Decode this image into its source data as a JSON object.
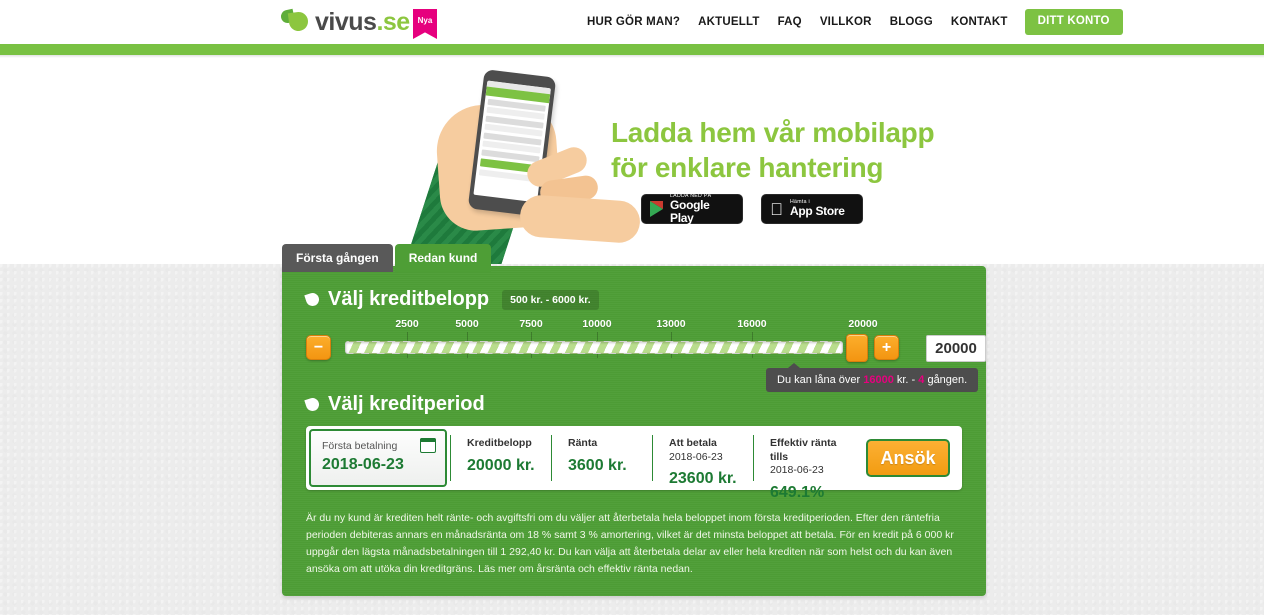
{
  "header": {
    "logo": {
      "name": "vivus",
      "domain": ".se",
      "ribbon": "Nya"
    },
    "nav": [
      {
        "label": "HUR GÖR MAN?",
        "name": "nav-hur-gor-man"
      },
      {
        "label": "AKTUELLT",
        "name": "nav-aktuellt"
      },
      {
        "label": "FAQ",
        "name": "nav-faq"
      },
      {
        "label": "VILLKOR",
        "name": "nav-villkor"
      },
      {
        "label": "BLOGG",
        "name": "nav-blogg"
      },
      {
        "label": "KONTAKT",
        "name": "nav-kontakt"
      }
    ],
    "cta": "DITT KONTO"
  },
  "hero": {
    "heading_line1": "Ladda hem vår mobilapp",
    "heading_line2": "för enklare hantering",
    "badges": [
      {
        "top": "LADDA NED PÅ",
        "bottom": "Google Play",
        "icon": "google-play-icon"
      },
      {
        "top": "Hämta i",
        "bottom": "App Store",
        "icon": "apple-icon"
      }
    ]
  },
  "tabs": [
    {
      "label": "Första gången",
      "active": false
    },
    {
      "label": "Redan kund",
      "active": true
    }
  ],
  "calculator": {
    "amount_section": {
      "title": "Välj kreditbelopp",
      "range_pill": "500 kr. - 6000 kr.",
      "ticks": [
        "2500",
        "5000",
        "7500",
        "10000",
        "13000",
        "16000",
        "20000"
      ],
      "minus_label": "−",
      "plus_label": "+",
      "value": "20000",
      "tooltip_prefix": "Du kan låna över ",
      "tooltip_amount": "16000",
      "tooltip_middle": " kr. - ",
      "tooltip_count": "4",
      "tooltip_suffix": " gången."
    },
    "period_section": {
      "title": "Välj kreditperiod"
    },
    "summary": {
      "date_card": {
        "label": "Första betalning",
        "value": "2018-06-23"
      },
      "cells": [
        {
          "label": "Kreditbelopp",
          "sub": "",
          "value": "20000 kr."
        },
        {
          "label": "Ränta",
          "sub": "",
          "value": "3600 kr."
        },
        {
          "label": "Att betala",
          "sub": "2018-06-23",
          "value": "23600 kr."
        },
        {
          "label": "Effektiv ränta tills",
          "sub": "2018-06-23",
          "value": "649.1%"
        }
      ],
      "apply_label": "Ansök"
    },
    "legal_text": "Är du ny kund är krediten helt ränte- och avgiftsfri om du väljer att återbetala hela beloppet inom första kreditperioden. Efter den räntefria perioden debiteras annars en månadsränta om 18 % samt 3 % amortering, vilket är det minsta beloppet att betala. För en kredit på 6 000 kr uppgår den lägsta månadsbetalningen till 1 292,40 kr. Du kan välja att återbetala delar av eller hela krediten när som helst och du kan även ansöka om att utöka din kreditgräns. Läs mer om årsränta och effektiv ränta nedan."
  },
  "colors": {
    "brand_green": "#79c143",
    "panel_green": "#4e9e36",
    "accent_orange": "#f39511",
    "dark_green_text": "#1d7a33",
    "pink": "#e6007e",
    "page_bg": "#ececec"
  }
}
